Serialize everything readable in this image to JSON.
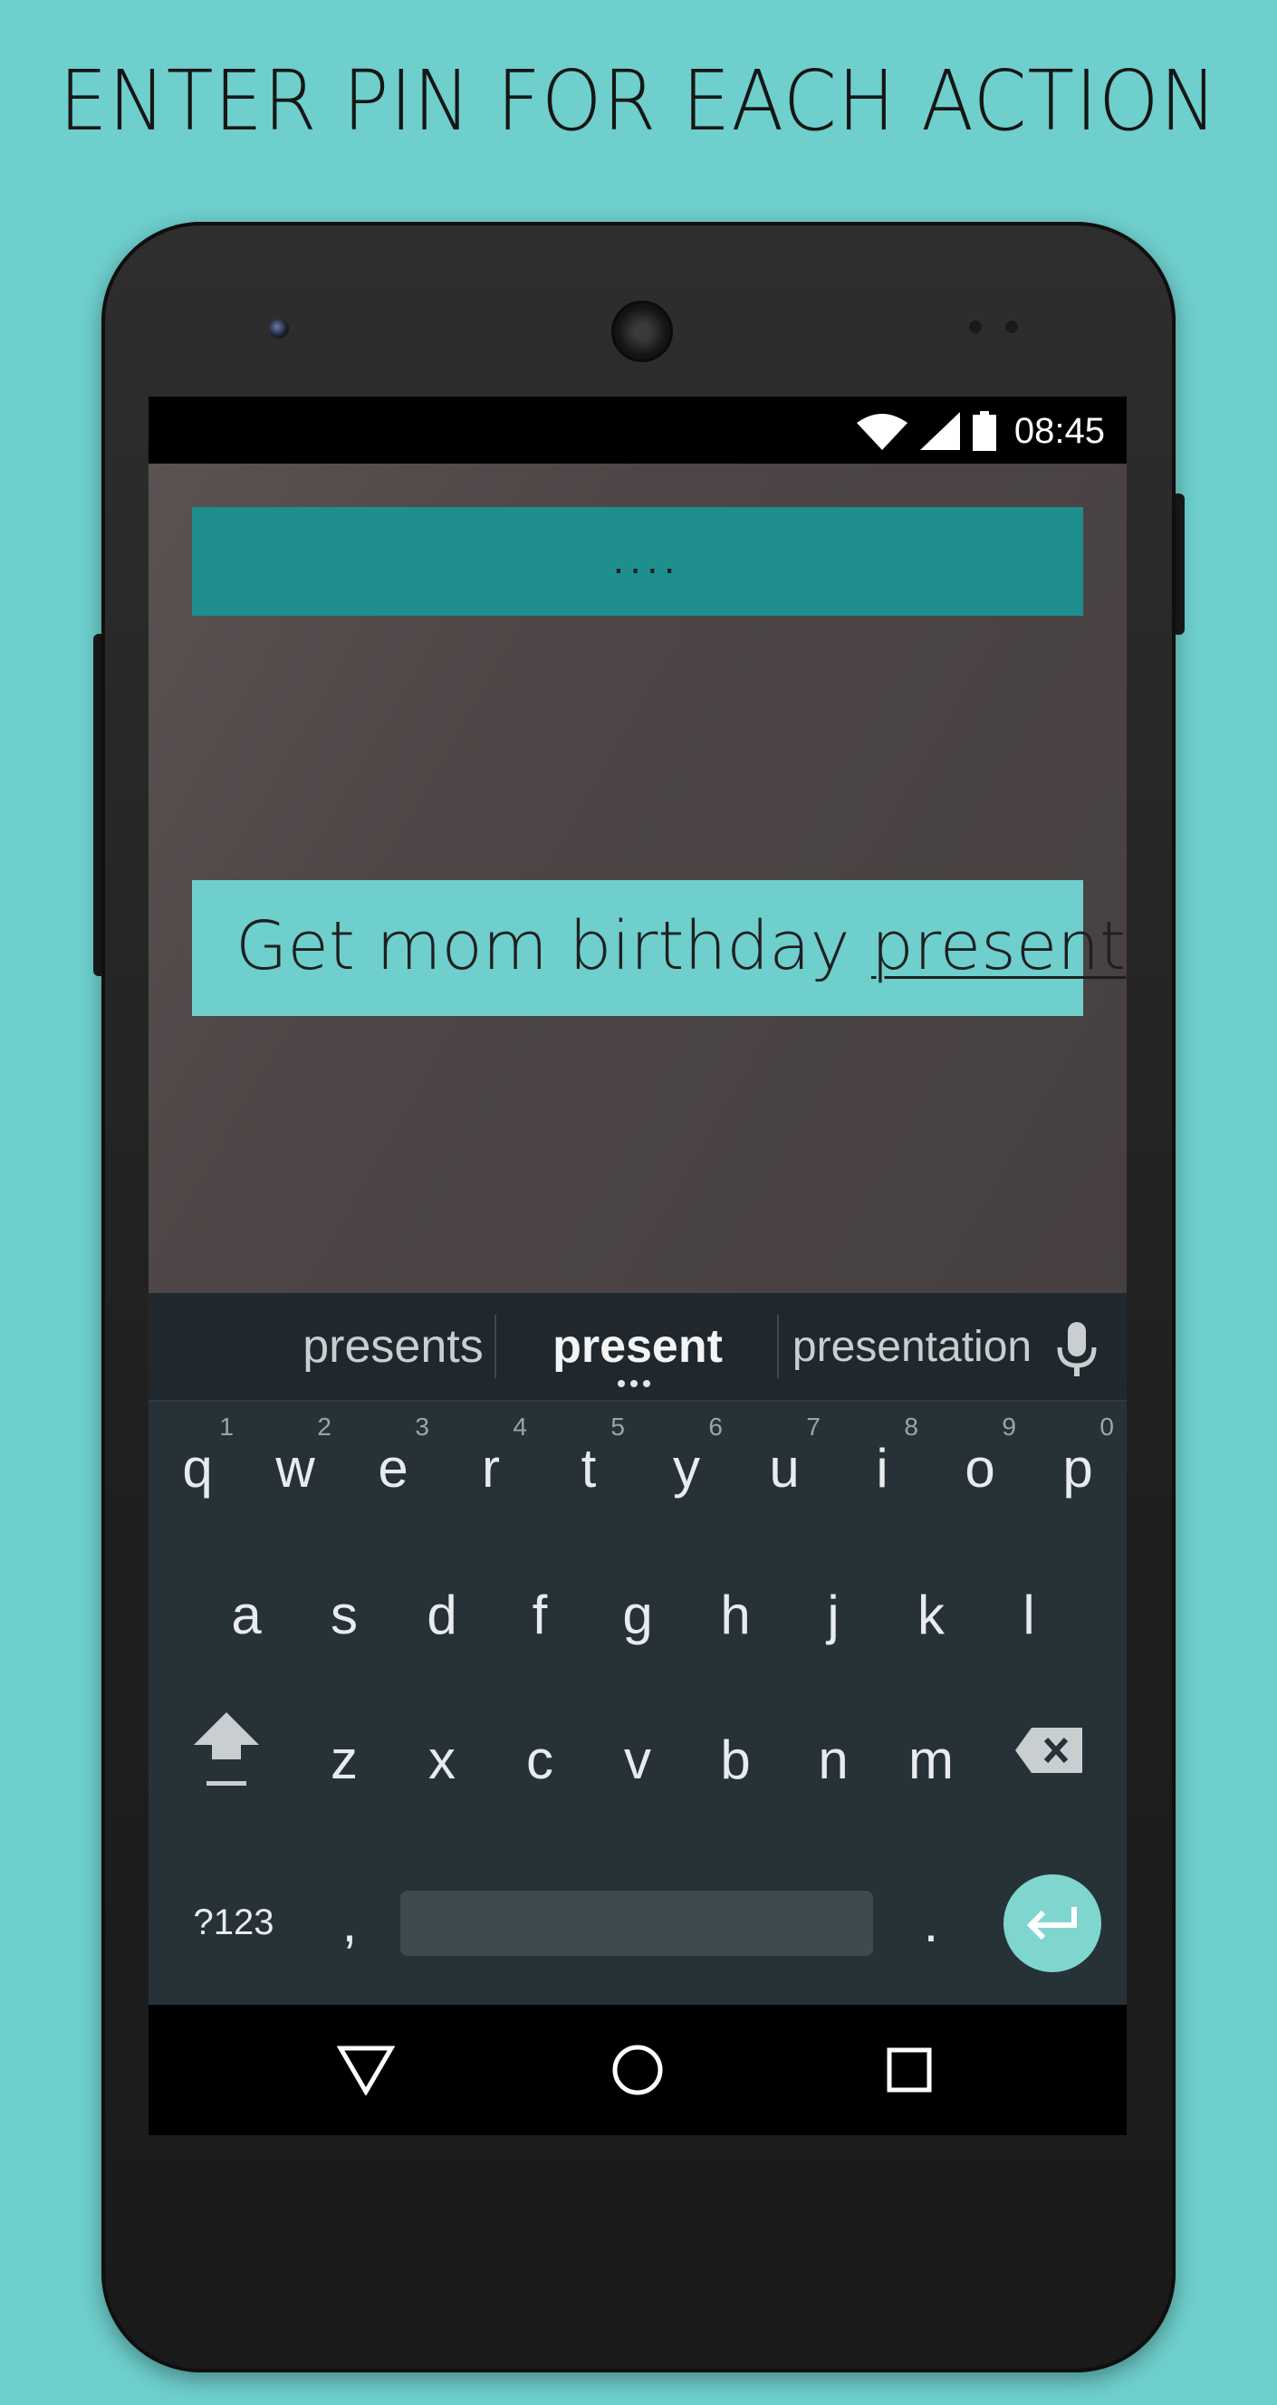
{
  "headline": "ENTER PIN FOR EACH ACTION",
  "status_bar": {
    "time": "08:45",
    "icons": [
      "wifi-icon",
      "cell-signal-icon",
      "battery-icon"
    ]
  },
  "pin_field": {
    "masked_value": "...."
  },
  "task_input": {
    "prefix": "Get mom birthday ",
    "composing_word": "present"
  },
  "keyboard": {
    "suggestions": [
      "presents",
      "present",
      "presentation"
    ],
    "rows": [
      [
        {
          "k": "q",
          "h": "1"
        },
        {
          "k": "w",
          "h": "2"
        },
        {
          "k": "e",
          "h": "3"
        },
        {
          "k": "r",
          "h": "4"
        },
        {
          "k": "t",
          "h": "5"
        },
        {
          "k": "y",
          "h": "6"
        },
        {
          "k": "u",
          "h": "7"
        },
        {
          "k": "i",
          "h": "8"
        },
        {
          "k": "o",
          "h": "9"
        },
        {
          "k": "p",
          "h": "0"
        }
      ],
      [
        {
          "k": "a"
        },
        {
          "k": "s"
        },
        {
          "k": "d"
        },
        {
          "k": "f"
        },
        {
          "k": "g"
        },
        {
          "k": "h"
        },
        {
          "k": "j"
        },
        {
          "k": "k"
        },
        {
          "k": "l"
        }
      ],
      [
        {
          "k": "z"
        },
        {
          "k": "x"
        },
        {
          "k": "c"
        },
        {
          "k": "v"
        },
        {
          "k": "b"
        },
        {
          "k": "n"
        },
        {
          "k": "m"
        }
      ]
    ],
    "symbols_key": "?123",
    "comma_key": ",",
    "period_key": "."
  },
  "nav_bar": [
    "back-icon",
    "home-icon",
    "recents-icon"
  ],
  "colors": {
    "background": "#6ecfcc",
    "accent_teal": "#1f8e8e",
    "keyboard_bg": "#263238"
  }
}
